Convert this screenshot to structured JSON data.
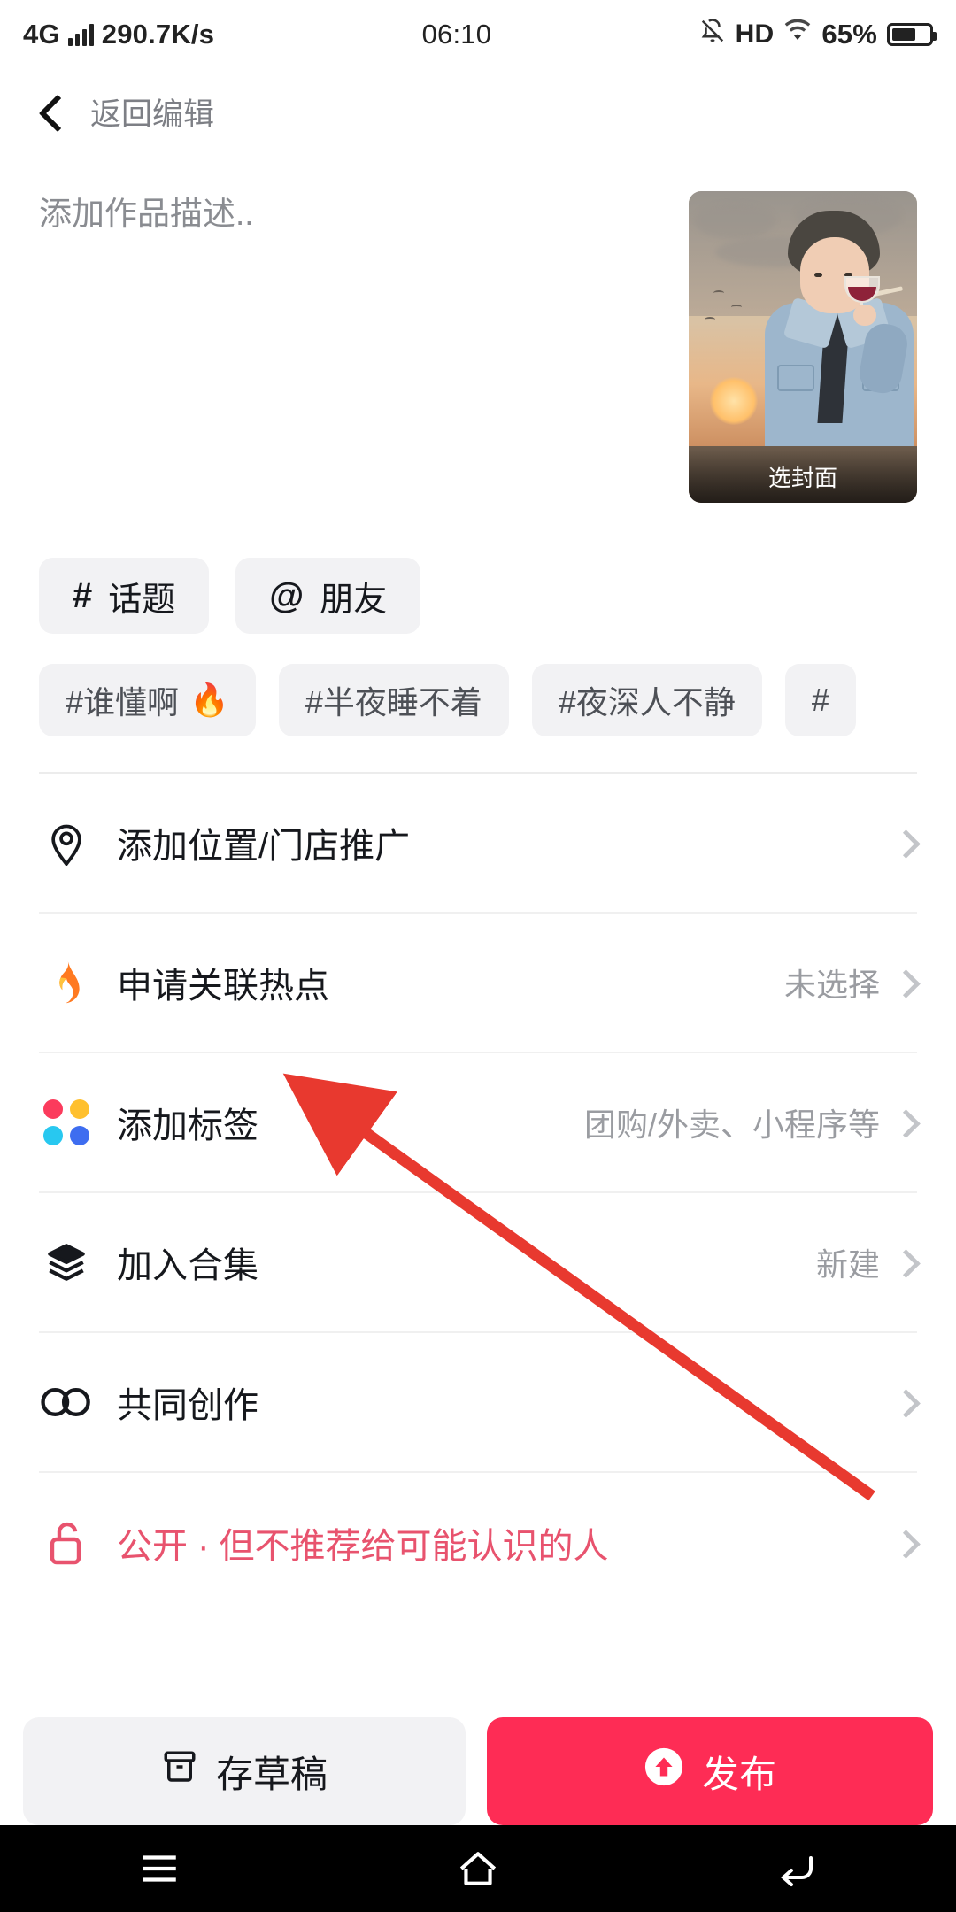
{
  "status_bar": {
    "network_type": "4G",
    "speed": "290.7K/s",
    "time": "06:10",
    "hd_label": "HD",
    "battery_percent": "65%",
    "icons": [
      "signal-bars-icon",
      "bell-off-icon",
      "hd-icon",
      "wifi-icon",
      "battery-icon"
    ]
  },
  "nav": {
    "back_label": "返回编辑",
    "back_icon": "chevron-left-icon"
  },
  "composer": {
    "description_placeholder": "添加作品描述..",
    "cover_label": "选封面"
  },
  "quick_buttons": [
    {
      "symbol": "#",
      "label": "话题",
      "name": "topic-button"
    },
    {
      "symbol": "@",
      "label": "朋友",
      "name": "friend-button"
    }
  ],
  "suggested_tags": [
    {
      "label": "#谁懂啊",
      "emoji": "🔥"
    },
    {
      "label": "#半夜睡不着",
      "emoji": ""
    },
    {
      "label": "#夜深人不静",
      "emoji": ""
    },
    {
      "label": "#",
      "emoji": ""
    }
  ],
  "options": [
    {
      "icon": "location-pin-icon",
      "label": "添加位置/门店推广",
      "value": "",
      "danger": false,
      "name": "option-location"
    },
    {
      "icon": "flame-icon",
      "label": "申请关联热点",
      "value": "未选择",
      "danger": false,
      "name": "option-hotspot"
    },
    {
      "icon": "color-dots-icon",
      "label": "添加标签",
      "value": "团购/外卖、小程序等",
      "danger": false,
      "name": "option-add-tag"
    },
    {
      "icon": "layers-icon",
      "label": "加入合集",
      "value": "新建",
      "danger": false,
      "name": "option-collection"
    },
    {
      "icon": "co-create-icon",
      "label": "共同创作",
      "value": "",
      "danger": false,
      "name": "option-cocreate"
    },
    {
      "icon": "unlock-icon",
      "label": "公开 · 但不推荐给可能认识的人",
      "value": "",
      "danger": true,
      "name": "option-privacy"
    }
  ],
  "actions": {
    "draft_label": "存草稿",
    "draft_icon": "archive-box-icon",
    "publish_label": "发布",
    "publish_icon": "arrow-up-circle-icon"
  },
  "android_nav": {
    "recents_icon": "menu-icon",
    "home_icon": "home-icon",
    "back_icon": "back-arrow-icon"
  },
  "colors": {
    "accent": "#fe2c55",
    "danger_text": "#e8536e",
    "chip_bg": "#f2f2f4",
    "muted_text": "#9a9ca1",
    "annotation_arrow": "#e8392f"
  }
}
